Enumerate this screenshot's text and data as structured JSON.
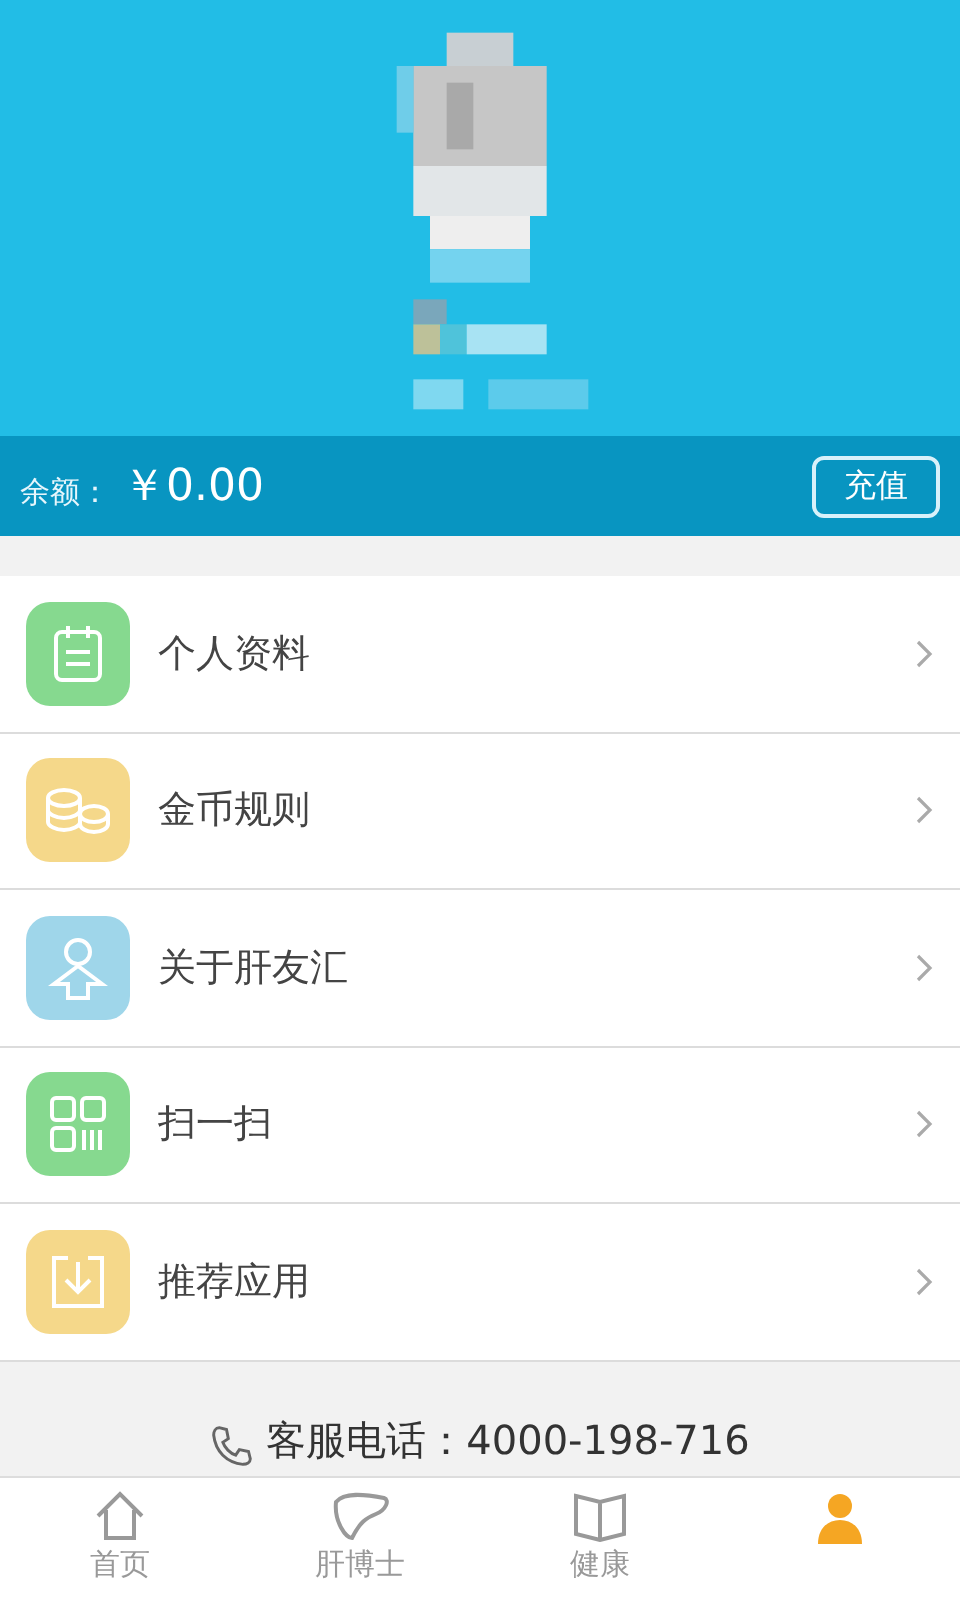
{
  "balance": {
    "label": "余额：",
    "amount": "￥0.00",
    "button": "充值"
  },
  "menu": [
    {
      "kind": "profile",
      "label": "个人资料",
      "color": "#86d98f"
    },
    {
      "kind": "coins",
      "label": "金币规则",
      "color": "#f5d88a"
    },
    {
      "kind": "about",
      "label": "关于肝友汇",
      "color": "#9fd6ea"
    },
    {
      "kind": "scan",
      "label": "扫一扫",
      "color": "#86d98f"
    },
    {
      "kind": "download",
      "label": "推荐应用",
      "color": "#f5d88a"
    }
  ],
  "hotline": "客服电话：4000-198-716",
  "tabs": [
    {
      "kind": "home",
      "label": "首页",
      "selected": false
    },
    {
      "kind": "liver",
      "label": "肝博士",
      "selected": false
    },
    {
      "kind": "book",
      "label": "健康",
      "selected": false
    },
    {
      "kind": "person",
      "selected": true
    }
  ]
}
